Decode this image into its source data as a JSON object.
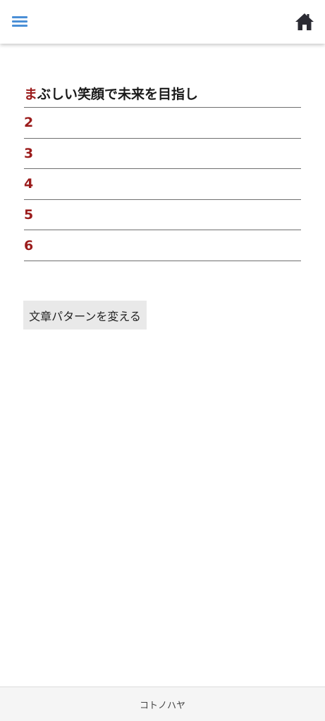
{
  "header": {
    "menu_icon": "hamburger-menu-icon",
    "home_icon": "home-icon",
    "menu_color": "#4a8fd6"
  },
  "rows": [
    {
      "initial": "ま",
      "rest": "ぶしい笑顔で未来を目指し"
    },
    {
      "initial": "2",
      "rest": ""
    },
    {
      "initial": "3",
      "rest": ""
    },
    {
      "initial": "4",
      "rest": ""
    },
    {
      "initial": "5",
      "rest": ""
    },
    {
      "initial": "6",
      "rest": ""
    }
  ],
  "accent_color": "#9b1c1c",
  "action_button": {
    "label": "文章パターンを変える"
  },
  "footer": {
    "text": "コトノハヤ"
  }
}
